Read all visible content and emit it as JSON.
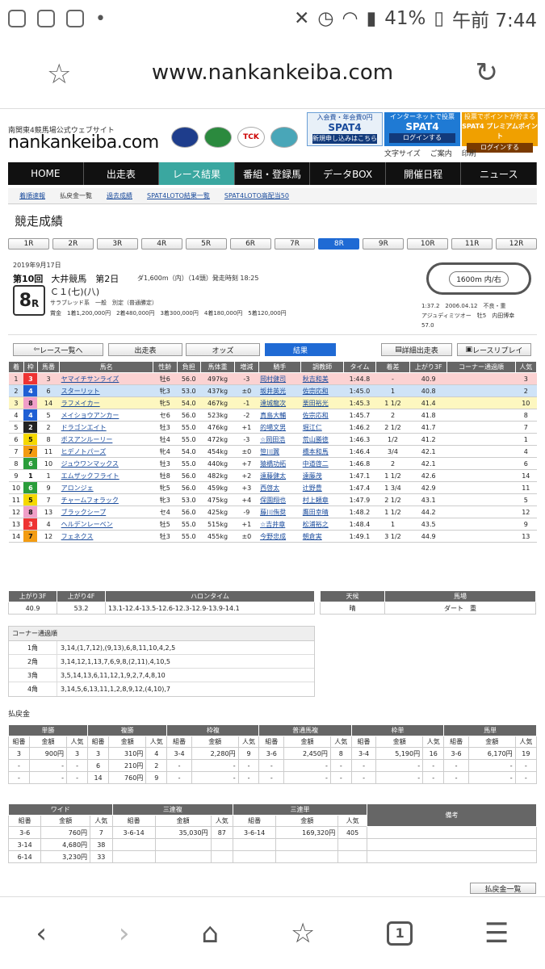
{
  "status": {
    "battery": "41%",
    "time": "午前 7:44"
  },
  "browser": {
    "url": "www.nankankeiba.com",
    "tab_count": "1"
  },
  "site": {
    "subtitle": "南関東4競馬場公式ウェブサイト",
    "logo": "nankankeiba.com",
    "ads": [
      {
        "top": "入会費・年会費0円",
        "main": "SPAT4",
        "foot": "新規申し込みはこちら"
      },
      {
        "top": "インターネットで投票",
        "main": "SPAT4",
        "foot": "ログインする"
      },
      {
        "top": "投票でポイントが貯まる",
        "main": "SPAT4 プレミアムポイント",
        "foot": "ログインする"
      }
    ],
    "tools": [
      "文字サイズ",
      "ご案内",
      "印刷"
    ],
    "gnav": [
      "HOME",
      "出走表",
      "レース結果",
      "番組・登録馬",
      "データBOX",
      "開催日程",
      "ニュース"
    ],
    "subnav": [
      "着順速報",
      "払戻金一覧",
      "過去成績",
      "SPAT4LOTO結果一覧",
      "SPAT4LOTO高配当50"
    ]
  },
  "page_title": "競走成績",
  "race_tabs": [
    "1R",
    "2R",
    "3R",
    "4R",
    "5R",
    "6R",
    "7R",
    "8R",
    "9R",
    "10R",
    "11R",
    "12R"
  ],
  "race": {
    "date": "2019年9月17日",
    "meet_no": "第10回",
    "meet": "大井競馬　第2日",
    "course": "ダ1,600m（内）（14頭）発走時刻 18:25",
    "race_no": "8",
    "race_unit": "R",
    "class": "Ｃ１(七)(八)",
    "conditions": "サラブレッド系　一般　別定（普通勝定）",
    "prize": "賞金　1着1,200,000円　2着480,000円　3着300,000円　4着180,000円　5着120,000円",
    "track_label": "1600m 内/右",
    "record_1": "1:37.2　2006.04.12　不良・重",
    "record_2": "アジュディミツオー　牡5　内田博幸",
    "record_3": "57.0"
  },
  "actions": {
    "back": "レース一覧へ",
    "card": "出走表",
    "odds": "オッズ",
    "result": "結果",
    "detail": "詳細出走表",
    "replay": "レースリプレイ"
  },
  "results": {
    "headers": [
      "着",
      "枠",
      "馬番",
      "馬名",
      "性齢",
      "負担",
      "馬体重",
      "増減",
      "騎手",
      "調教師",
      "タイム",
      "着差",
      "上がり3F",
      "コーナー通過順",
      "人気"
    ],
    "rows": [
      [
        "1",
        "3",
        "3",
        "ヤマイチサンライズ",
        "牡6",
        "56.0",
        "497kg",
        "-3",
        "岡村健司",
        "秋吉和美",
        "1:44.8",
        "-",
        "40.9",
        "",
        "3"
      ],
      [
        "2",
        "4",
        "6",
        "スターリット",
        "牝3",
        "53.0",
        "437kg",
        "±0",
        "坂井英光",
        "佐宗応和",
        "1:45.0",
        "1",
        "40.8",
        "",
        "2"
      ],
      [
        "3",
        "8",
        "14",
        "ラフメイカー",
        "牝5",
        "54.0",
        "467kg",
        "-1",
        "達城龍次",
        "栗田裕光",
        "1:45.3",
        "1 1/2",
        "41.4",
        "",
        "10"
      ],
      [
        "4",
        "4",
        "5",
        "メイショウアンカー",
        "セ6",
        "56.0",
        "523kg",
        "-2",
        "真島大輔",
        "佐宗応和",
        "1:45.7",
        "2",
        "41.8",
        "",
        "8"
      ],
      [
        "5",
        "2",
        "2",
        "ドラゴンエイト",
        "牡3",
        "55.0",
        "476kg",
        "+1",
        "的場文男",
        "堀江仁",
        "1:46.2",
        "2 1/2",
        "41.7",
        "",
        "7"
      ],
      [
        "6",
        "5",
        "8",
        "ボスアンルーリー",
        "牡4",
        "55.0",
        "472kg",
        "-3",
        "☆岡田浩",
        "荒山勝徳",
        "1:46.3",
        "1/2",
        "41.2",
        "",
        "1"
      ],
      [
        "7",
        "7",
        "11",
        "ヒデノトパーズ",
        "牝4",
        "54.0",
        "454kg",
        "±0",
        "笹川翼",
        "橋本和馬",
        "1:46.4",
        "3/4",
        "42.1",
        "",
        "4"
      ],
      [
        "8",
        "6",
        "10",
        "ジュウワンマックス",
        "牡3",
        "55.0",
        "440kg",
        "+7",
        "猿橋功拓",
        "中道啓二",
        "1:46.8",
        "2",
        "42.1",
        "",
        "6"
      ],
      [
        "9",
        "1",
        "1",
        "エムザックフライト",
        "牡8",
        "56.0",
        "482kg",
        "+2",
        "遠藤健太",
        "遠藤茂",
        "1:47.1",
        "1 1/2",
        "42.6",
        "",
        "14"
      ],
      [
        "10",
        "6",
        "9",
        "アロンジェ",
        "牝5",
        "56.0",
        "459kg",
        "+3",
        "西啓太",
        "辻野豊",
        "1:47.4",
        "1 3/4",
        "42.9",
        "",
        "11"
      ],
      [
        "11",
        "5",
        "7",
        "チャームフォラック",
        "牝3",
        "53.0",
        "475kg",
        "+4",
        "保園翔也",
        "村上頼章",
        "1:47.9",
        "2 1/2",
        "43.1",
        "",
        "5"
      ],
      [
        "12",
        "8",
        "13",
        "ブラックシープ",
        "セ4",
        "56.0",
        "425kg",
        "-9",
        "藤川侑奨",
        "鷹田幸晴",
        "1:48.2",
        "1 1/2",
        "44.2",
        "",
        "12"
      ],
      [
        "13",
        "3",
        "4",
        "ヘルデンレーベン",
        "牡5",
        "55.0",
        "515kg",
        "+1",
        "☆吉井章",
        "松浦裕之",
        "1:48.4",
        "1",
        "43.5",
        "",
        "9"
      ],
      [
        "14",
        "7",
        "12",
        "フェネクス",
        "牡3",
        "55.0",
        "455kg",
        "±0",
        "今野忠成",
        "朝倉実",
        "1:49.1",
        "3 1/2",
        "44.9",
        "",
        "13"
      ]
    ]
  },
  "furlong": {
    "headers": [
      "上がり3F",
      "上がり4F",
      "ハロンタイム"
    ],
    "values": [
      "40.9",
      "53.2",
      "13.1-12.4-13.5-12.6-12.3-12.9-13.9-14.1"
    ]
  },
  "weather": {
    "headers": [
      "天候",
      "馬場"
    ],
    "values": [
      "晴",
      "ダート　重"
    ]
  },
  "corner": {
    "title": "コーナー通過順",
    "rows": [
      [
        "1角",
        "3,14,(1,7,12),(9,13),6,8,11,10,4,2,5"
      ],
      [
        "2角",
        "3,14,12,1,13,7,6,9,8,(2,11),4,10,5"
      ],
      [
        "3角",
        "3,5,14,13,6,11,12,1,9,2,7,4,8,10"
      ],
      [
        "4角",
        "3,14,5,6,13,11,1,2,8,9,12,(4,10),7"
      ]
    ]
  },
  "payout_title": "払戻金",
  "payout1": {
    "groups": [
      "単勝",
      "複勝",
      "枠複",
      "普通馬複",
      "枠単",
      "馬単"
    ],
    "sub": [
      "組番",
      "金額",
      "人気"
    ],
    "rows": [
      [
        "3",
        "900円",
        "3",
        "3",
        "310円",
        "4",
        "3-4",
        "2,280円",
        "9",
        "3-6",
        "2,450円",
        "8",
        "3-4",
        "5,190円",
        "16",
        "3-6",
        "6,170円",
        "19"
      ],
      [
        "-",
        "-",
        "-",
        "6",
        "210円",
        "2",
        "-",
        "-",
        "-",
        "-",
        "-",
        "-",
        "-",
        "-",
        "-",
        "-",
        "-",
        "-"
      ],
      [
        "-",
        "-",
        "-",
        "14",
        "760円",
        "9",
        "-",
        "-",
        "-",
        "-",
        "-",
        "-",
        "-",
        "-",
        "-",
        "-",
        "-",
        "-"
      ]
    ]
  },
  "payout2": {
    "groups": [
      "ワイド",
      "三連複",
      "三連単",
      "備考"
    ],
    "sub": [
      "組番",
      "金額",
      "人気"
    ],
    "rows": [
      [
        "3-6",
        "760円",
        "7",
        "3-6-14",
        "35,030円",
        "87",
        "3-6-14",
        "169,320円",
        "405"
      ],
      [
        "3-14",
        "4,680円",
        "38",
        "",
        "",
        "",
        "",
        "",
        ""
      ],
      [
        "6-14",
        "3,230円",
        "33",
        "",
        "",
        "",
        "",
        "",
        ""
      ]
    ]
  },
  "payout_all": "払戻金一覧",
  "colors": {
    "accent": "#1f6ad4",
    "nav_active": "#3aa7a0",
    "header_bg": "#666666"
  }
}
